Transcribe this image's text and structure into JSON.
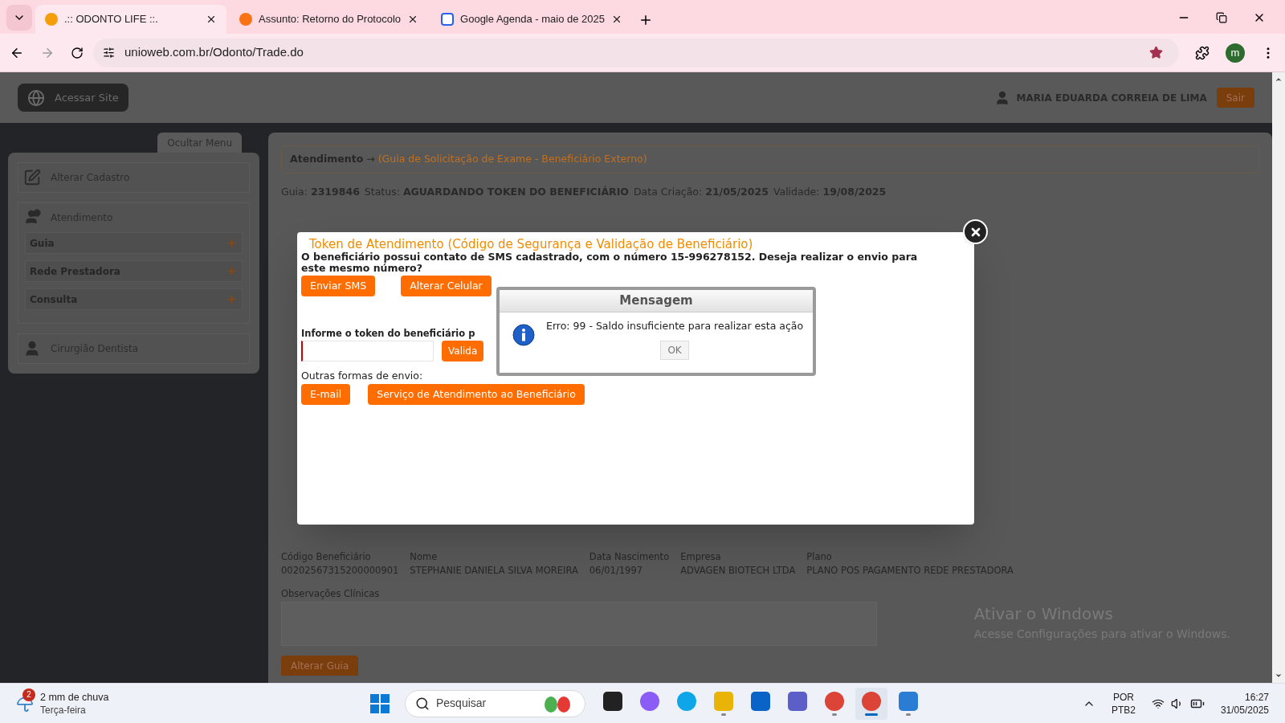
{
  "browser": {
    "tabs": [
      {
        "title": ".:: ODONTO LIFE ::.",
        "kind": "odonto",
        "selected": true
      },
      {
        "title": "Assunto: Retorno do Protocolo",
        "kind": "mail",
        "selected": false
      },
      {
        "title": "Google Agenda - maio de 2025",
        "kind": "calendar",
        "selected": false
      }
    ],
    "url": "unioweb.com.br/Odonto/Trade.do",
    "bookmarked": true,
    "profile": "m"
  },
  "header": {
    "site_button": "Acessar Site",
    "user": "MARIA EDUARDA CORREIA DE LIMA",
    "logout": "Sair"
  },
  "sidebar": {
    "toggle": "Ocultar Menu",
    "sections": [
      {
        "label": "Alterar Cadastro",
        "kind": "edit"
      },
      {
        "label": "Atendimento",
        "kind": "service",
        "items": [
          {
            "label": "Guia",
            "expanded": false
          },
          {
            "label": "Rede Prestadora",
            "expanded": false
          },
          {
            "label": "Consulta",
            "expanded": false
          }
        ]
      },
      {
        "label": "Cirurgião Dentista",
        "kind": "dentist"
      }
    ]
  },
  "main": {
    "breadcrumb": {
      "section": "Atendimento",
      "arrow": "→",
      "detail": "(Guia de Solicitação de Exame - Beneficiário Externo)"
    },
    "summary": [
      {
        "label": "Guia:",
        "value": "2319846"
      },
      {
        "label": "Status:",
        "value": "AGUARDANDO TOKEN DO BENEFICIÁRIO"
      },
      {
        "label": "Data Criação:",
        "value": "21/05/2025"
      },
      {
        "label": "Validade:",
        "value": "19/08/2025"
      }
    ],
    "beneficiary": [
      {
        "label": "Código Beneficiário",
        "value": "00202567315200000901"
      },
      {
        "label": "Nome",
        "value": "STEPHANIE DANIELA SILVA MOREIRA"
      },
      {
        "label": "Data Nascimento",
        "value": "06/01/1997"
      },
      {
        "label": "Empresa",
        "value": "ADVAGEN BIOTECH LTDA"
      },
      {
        "label": "Plano",
        "value": "PLANO POS PAGAMENTO REDE PRESTADORA"
      }
    ],
    "observations_label": "Observações Clínicas",
    "edit_button": "Alterar Guia"
  },
  "token_modal": {
    "title": "Token de Atendimento (Código de Segurança e Validação de Beneficiário)",
    "message": "O beneficiário possui contato de SMS cadastrado, com o número 15-996278152. Deseja realizar o envio para este mesmo número?",
    "buttons": [
      "Enviar SMS",
      "Alterar Celular"
    ],
    "token_label": "Informe o token do beneficiário p",
    "validate_button": "Valida",
    "other_label": "Outras formas de envio:",
    "other_buttons": [
      "E-mail",
      "Serviço de Atendimento ao Beneficiário"
    ]
  },
  "message_dialog": {
    "title": "Mensagem",
    "text": "Erro: 99 - Saldo insuficiente para realizar esta ação",
    "ok": "OK"
  },
  "watermark": {
    "title": "Ativar o Windows",
    "subtitle": "Acesse Configurações para ativar o Windows."
  },
  "taskbar": {
    "weather": {
      "badge": "2",
      "text": "2 mm de chuva",
      "day": "Terça-feira"
    },
    "search_placeholder": "Pesquisar",
    "apps": [
      {
        "kind": "files-dark",
        "running": false,
        "selected": false
      },
      {
        "kind": "copilot",
        "running": false,
        "selected": false
      },
      {
        "kind": "edge",
        "running": false,
        "selected": false
      },
      {
        "kind": "folder",
        "running": true,
        "selected": false
      },
      {
        "kind": "outlook",
        "running": false,
        "selected": false
      },
      {
        "kind": "teams",
        "running": false,
        "selected": false
      },
      {
        "kind": "chrome",
        "running": true,
        "selected": false
      },
      {
        "kind": "chrome",
        "running": true,
        "selected": true
      },
      {
        "kind": "doc",
        "running": true,
        "selected": false
      }
    ],
    "language": "POR",
    "layout": "PTB2",
    "time": "16:27",
    "date": "31/05/2025"
  }
}
